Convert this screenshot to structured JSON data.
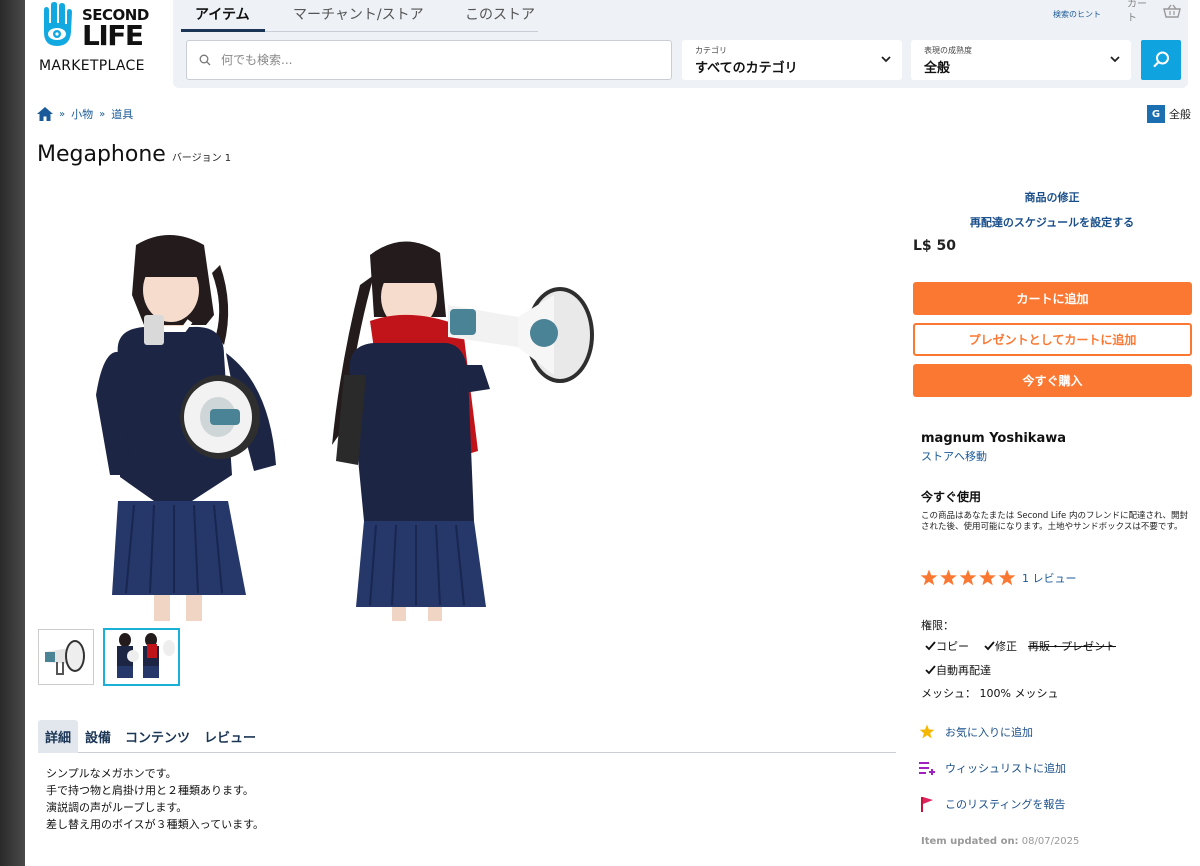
{
  "logo": {
    "line1": "SECOND",
    "line2": "LIFE",
    "trademark": "™",
    "sub": "MARKETPLACE"
  },
  "nav": {
    "tabs": [
      "アイテム",
      "マーチャント/ストア",
      "このストア"
    ],
    "active_tab": 0,
    "search_placeholder": "何でも検索...",
    "category_caption": "カテゴリ",
    "category_value": "すべてのカテゴリ",
    "maturity_caption": "表現の成熟度",
    "maturity_value": "全般",
    "search_hint": "検索のヒント",
    "cart_label": "カート"
  },
  "breadcrumb": {
    "items": [
      "小物",
      "道具"
    ],
    "separator": "»"
  },
  "maturity_badge": {
    "letter": "G",
    "label": "全般"
  },
  "product": {
    "name": "Megaphone",
    "version": "バージョン 1",
    "tabs": [
      "詳細",
      "設備",
      "コンテンツ",
      "レビュー"
    ],
    "active_tab": 0,
    "description": [
      "シンプルなメガホンです。",
      "手で持つ物と肩掛け用と２種類あります。",
      "演説調の声がループします。",
      "差し替え用のボイスが３種類入っています。"
    ]
  },
  "sidebar": {
    "edit_link": "商品の修正",
    "schedule_link": "再配達のスケジュールを設定する",
    "price": "L$ 50",
    "add_to_cart": "カートに追加",
    "gift_to_cart": "プレゼントとしてカートに追加",
    "buy_now": "今すぐ購入",
    "seller": "magnum Yoshikawa",
    "store_link": "ストアへ移動",
    "use_now_title": "今すぐ使用",
    "use_now_desc": "この商品はあなたまたは Second Life 内のフレンドに配達され、開封された後、使用可能になります。土地やサンドボックスは不要です。",
    "rating": 5,
    "reviews": "1 レビュー",
    "perm_title": "権限：",
    "perm_copy": "コピー",
    "perm_modify": "修正",
    "perm_transfer": "再販・プレゼント",
    "perm_redeliver": "自動再配達",
    "mesh": "メッシュ： 100% メッシュ",
    "favorite": "お気に入りに追加",
    "wishlist": "ウィッシュリストに追加",
    "report": "このリスティングを報告",
    "updated_label": "Item updated on:",
    "updated_date": "08/07/2025"
  },
  "colors": {
    "accent_orange": "#fb7833",
    "link_blue": "#1a5a9a",
    "search_blue": "#0fa3e0",
    "logo_blue": "#12a9e0"
  }
}
